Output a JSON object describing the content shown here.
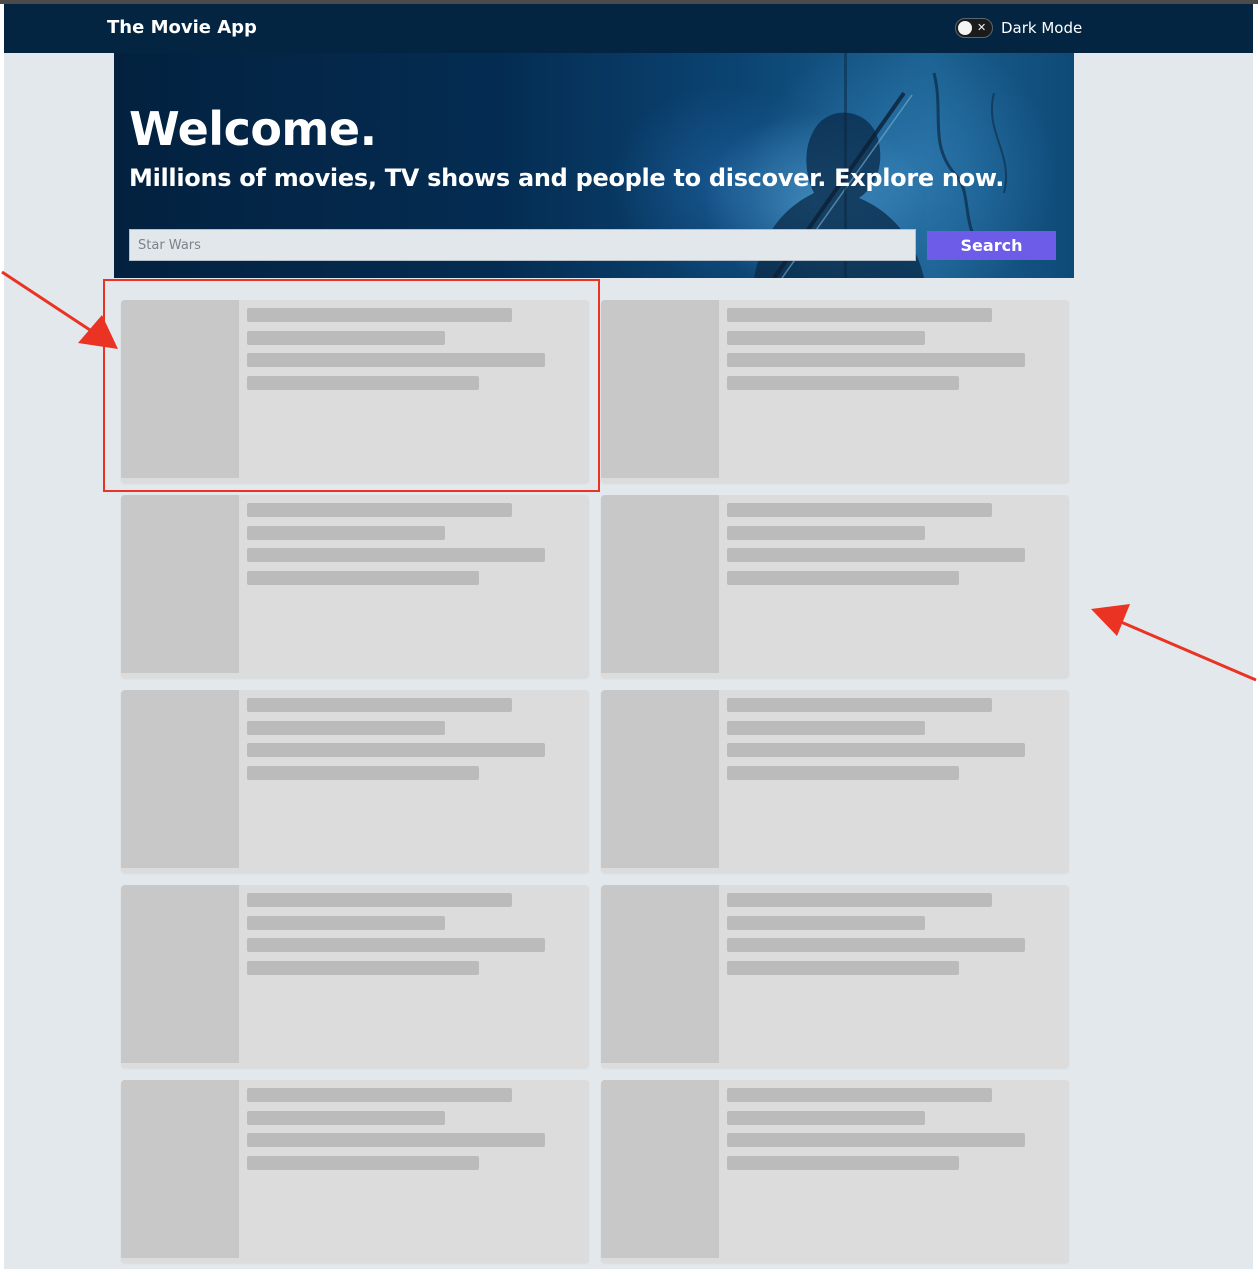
{
  "navbar": {
    "brand": "The Movie App",
    "dark_mode_label": "Dark Mode",
    "dark_mode_enabled": false
  },
  "hero": {
    "title": "Welcome.",
    "subtitle": "Millions of movies, TV shows and people to discover. Explore now."
  },
  "search": {
    "placeholder": "Star Wars",
    "button_label": "Search"
  },
  "results": {
    "state": "loading",
    "skeleton_count": 10
  },
  "colors": {
    "navbar": "#032541",
    "page_background": "#e3e8ec",
    "search_button": "#6c5ce7",
    "skeleton_card": "#dcdcdc",
    "skeleton_poster": "#c8c8c8",
    "skeleton_line": "#bcbbbc",
    "annotation": "#ea3323"
  },
  "icons": {
    "toggle_off": "x-icon"
  }
}
